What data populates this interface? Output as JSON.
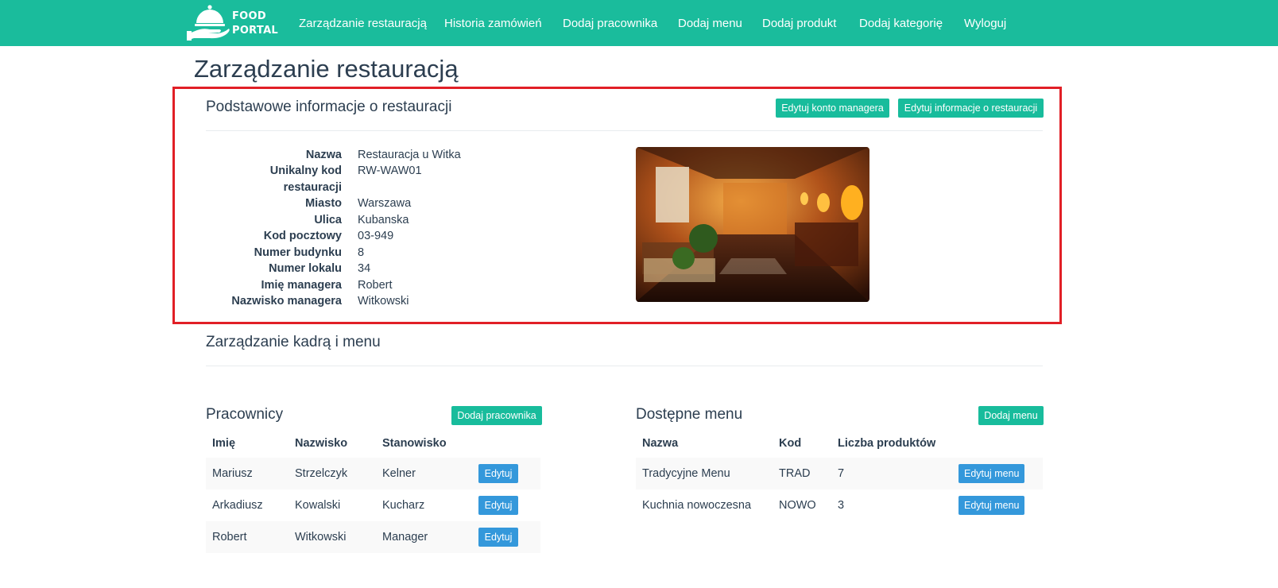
{
  "navbar": {
    "logo_line1": "FOOD",
    "logo_line2": "PORTAL",
    "items": [
      {
        "label": "Zarządzanie restauracją"
      },
      {
        "label": "Historia zamówień"
      },
      {
        "label": "Dodaj pracownika"
      },
      {
        "label": "Dodaj menu"
      },
      {
        "label": "Dodaj produkt"
      },
      {
        "label": "Dodaj kategorię"
      },
      {
        "label": "Wyloguj"
      }
    ]
  },
  "page_title": "Zarządzanie restauracją",
  "info_section": {
    "title": "Podstawowe informacje o restauracji",
    "edit_manager_label": "Edytuj konto managera",
    "edit_info_label": "Edytuj informacje o restauracji",
    "fields": [
      {
        "label": "Nazwa",
        "value": "Restauracja u Witka"
      },
      {
        "label": "Unikalny kod",
        "label2": "restauracji",
        "value": "RW-WAW01"
      },
      {
        "label": "Miasto",
        "value": "Warszawa"
      },
      {
        "label": "Ulica",
        "value": "Kubanska"
      },
      {
        "label": "Kod pocztowy",
        "value": "03-949"
      },
      {
        "label": "Numer budynku",
        "value": "8"
      },
      {
        "label": "Numer lokalu",
        "value": "34"
      },
      {
        "label": "Imię managera",
        "value": "Robert"
      },
      {
        "label": "Nazwisko managera",
        "value": "Witkowski"
      }
    ]
  },
  "staff_section": {
    "title": "Zarządzanie kadrą i menu"
  },
  "employees": {
    "title": "Pracownicy",
    "add_label": "Dodaj pracownika",
    "headers": [
      "Imię",
      "Nazwisko",
      "Stanowisko"
    ],
    "edit_label": "Edytuj",
    "rows": [
      {
        "first": "Mariusz",
        "last": "Strzelczyk",
        "position": "Kelner"
      },
      {
        "first": "Arkadiusz",
        "last": "Kowalski",
        "position": "Kucharz"
      },
      {
        "first": "Robert",
        "last": "Witkowski",
        "position": "Manager"
      }
    ]
  },
  "menus": {
    "title": "Dostępne menu",
    "add_label": "Dodaj menu",
    "headers": [
      "Nazwa",
      "Kod",
      "Liczba produktów"
    ],
    "edit_label": "Edytuj menu",
    "rows": [
      {
        "name": "Tradycyjne Menu",
        "code": "TRAD",
        "count": "7"
      },
      {
        "name": "Kuchnia nowoczesna",
        "code": "NOWO",
        "count": "3"
      }
    ]
  },
  "colors": {
    "navbar": "#1abc9c",
    "button_green": "#18bc9c",
    "button_blue": "#3498db",
    "highlight": "#e11f26",
    "text": "#2c3e50"
  }
}
